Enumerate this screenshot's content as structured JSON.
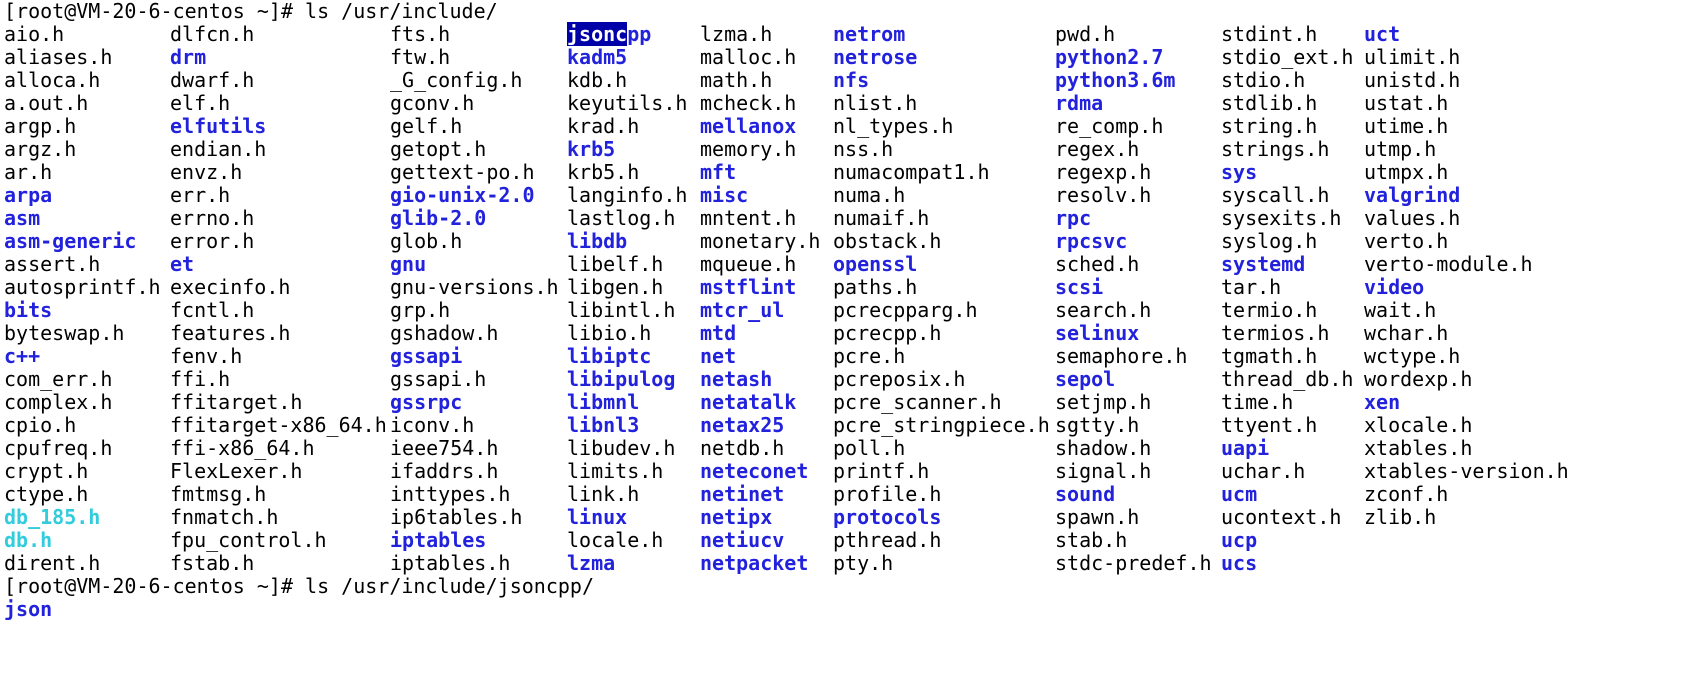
{
  "terminal": {
    "prompt1": "[root@VM-20-6-centos ~]# ls /usr/include/",
    "prompt2": "[root@VM-20-6-centos ~]# ls /usr/include/jsoncpp/",
    "second_output": [
      {
        "name": "json",
        "type": "dir"
      }
    ],
    "columns": [
      [
        {
          "name": "aio.h",
          "type": "file"
        },
        {
          "name": "aliases.h",
          "type": "file"
        },
        {
          "name": "alloca.h",
          "type": "file"
        },
        {
          "name": "a.out.h",
          "type": "file"
        },
        {
          "name": "argp.h",
          "type": "file"
        },
        {
          "name": "argz.h",
          "type": "file"
        },
        {
          "name": "ar.h",
          "type": "file"
        },
        {
          "name": "arpa",
          "type": "dir"
        },
        {
          "name": "asm",
          "type": "dir"
        },
        {
          "name": "asm-generic",
          "type": "dir"
        },
        {
          "name": "assert.h",
          "type": "file"
        },
        {
          "name": "autosprintf.h",
          "type": "file"
        },
        {
          "name": "bits",
          "type": "dir"
        },
        {
          "name": "byteswap.h",
          "type": "file"
        },
        {
          "name": "c++",
          "type": "dir"
        },
        {
          "name": "com_err.h",
          "type": "file"
        },
        {
          "name": "complex.h",
          "type": "file"
        },
        {
          "name": "cpio.h",
          "type": "file"
        },
        {
          "name": "cpufreq.h",
          "type": "file"
        },
        {
          "name": "crypt.h",
          "type": "file"
        },
        {
          "name": "ctype.h",
          "type": "file"
        },
        {
          "name": "db_185.h",
          "type": "link"
        },
        {
          "name": "db.h",
          "type": "link"
        },
        {
          "name": "dirent.h",
          "type": "file"
        }
      ],
      [
        {
          "name": "dlfcn.h",
          "type": "file"
        },
        {
          "name": "drm",
          "type": "dir"
        },
        {
          "name": "dwarf.h",
          "type": "file"
        },
        {
          "name": "elf.h",
          "type": "file"
        },
        {
          "name": "elfutils",
          "type": "dir"
        },
        {
          "name": "endian.h",
          "type": "file"
        },
        {
          "name": "envz.h",
          "type": "file"
        },
        {
          "name": "err.h",
          "type": "file"
        },
        {
          "name": "errno.h",
          "type": "file"
        },
        {
          "name": "error.h",
          "type": "file"
        },
        {
          "name": "et",
          "type": "dir"
        },
        {
          "name": "execinfo.h",
          "type": "file"
        },
        {
          "name": "fcntl.h",
          "type": "file"
        },
        {
          "name": "features.h",
          "type": "file"
        },
        {
          "name": "fenv.h",
          "type": "file"
        },
        {
          "name": "ffi.h",
          "type": "file"
        },
        {
          "name": "ffitarget.h",
          "type": "file"
        },
        {
          "name": "ffitarget-x86_64.h",
          "type": "file"
        },
        {
          "name": "ffi-x86_64.h",
          "type": "file"
        },
        {
          "name": "FlexLexer.h",
          "type": "file"
        },
        {
          "name": "fmtmsg.h",
          "type": "file"
        },
        {
          "name": "fnmatch.h",
          "type": "file"
        },
        {
          "name": "fpu_control.h",
          "type": "file"
        },
        {
          "name": "fstab.h",
          "type": "file"
        }
      ],
      [
        {
          "name": "fts.h",
          "type": "file"
        },
        {
          "name": "ftw.h",
          "type": "file"
        },
        {
          "name": "_G_config.h",
          "type": "file"
        },
        {
          "name": "gconv.h",
          "type": "file"
        },
        {
          "name": "gelf.h",
          "type": "file"
        },
        {
          "name": "getopt.h",
          "type": "file"
        },
        {
          "name": "gettext-po.h",
          "type": "file"
        },
        {
          "name": "gio-unix-2.0",
          "type": "dir"
        },
        {
          "name": "glib-2.0",
          "type": "dir"
        },
        {
          "name": "glob.h",
          "type": "file"
        },
        {
          "name": "gnu",
          "type": "dir"
        },
        {
          "name": "gnu-versions.h",
          "type": "file"
        },
        {
          "name": "grp.h",
          "type": "file"
        },
        {
          "name": "gshadow.h",
          "type": "file"
        },
        {
          "name": "gssapi",
          "type": "dir"
        },
        {
          "name": "gssapi.h",
          "type": "file"
        },
        {
          "name": "gssrpc",
          "type": "dir"
        },
        {
          "name": "iconv.h",
          "type": "file"
        },
        {
          "name": "ieee754.h",
          "type": "file"
        },
        {
          "name": "ifaddrs.h",
          "type": "file"
        },
        {
          "name": "inttypes.h",
          "type": "file"
        },
        {
          "name": "ip6tables.h",
          "type": "file"
        },
        {
          "name": "iptables",
          "type": "dir"
        },
        {
          "name": "iptables.h",
          "type": "file"
        }
      ],
      [
        {
          "name": "jsoncpp",
          "type": "dir",
          "selected_part": "jsonc",
          "rest_part": "pp"
        },
        {
          "name": "kadm5",
          "type": "dir"
        },
        {
          "name": "kdb.h",
          "type": "file"
        },
        {
          "name": "keyutils.h",
          "type": "file"
        },
        {
          "name": "krad.h",
          "type": "file"
        },
        {
          "name": "krb5",
          "type": "dir"
        },
        {
          "name": "krb5.h",
          "type": "file"
        },
        {
          "name": "langinfo.h",
          "type": "file"
        },
        {
          "name": "lastlog.h",
          "type": "file"
        },
        {
          "name": "libdb",
          "type": "dir"
        },
        {
          "name": "libelf.h",
          "type": "file"
        },
        {
          "name": "libgen.h",
          "type": "file"
        },
        {
          "name": "libintl.h",
          "type": "file"
        },
        {
          "name": "libio.h",
          "type": "file"
        },
        {
          "name": "libiptc",
          "type": "dir"
        },
        {
          "name": "libipulog",
          "type": "dir"
        },
        {
          "name": "libmnl",
          "type": "dir"
        },
        {
          "name": "libnl3",
          "type": "dir"
        },
        {
          "name": "libudev.h",
          "type": "file"
        },
        {
          "name": "limits.h",
          "type": "file"
        },
        {
          "name": "link.h",
          "type": "file"
        },
        {
          "name": "linux",
          "type": "dir"
        },
        {
          "name": "locale.h",
          "type": "file"
        },
        {
          "name": "lzma",
          "type": "dir"
        }
      ],
      [
        {
          "name": "lzma.h",
          "type": "file"
        },
        {
          "name": "malloc.h",
          "type": "file"
        },
        {
          "name": "math.h",
          "type": "file"
        },
        {
          "name": "mcheck.h",
          "type": "file"
        },
        {
          "name": "mellanox",
          "type": "dir"
        },
        {
          "name": "memory.h",
          "type": "file"
        },
        {
          "name": "mft",
          "type": "dir"
        },
        {
          "name": "misc",
          "type": "dir"
        },
        {
          "name": "mntent.h",
          "type": "file"
        },
        {
          "name": "monetary.h",
          "type": "file"
        },
        {
          "name": "mqueue.h",
          "type": "file"
        },
        {
          "name": "mstflint",
          "type": "dir"
        },
        {
          "name": "mtcr_ul",
          "type": "dir"
        },
        {
          "name": "mtd",
          "type": "dir"
        },
        {
          "name": "net",
          "type": "dir"
        },
        {
          "name": "netash",
          "type": "dir"
        },
        {
          "name": "netatalk",
          "type": "dir"
        },
        {
          "name": "netax25",
          "type": "dir"
        },
        {
          "name": "netdb.h",
          "type": "file"
        },
        {
          "name": "neteconet",
          "type": "dir"
        },
        {
          "name": "netinet",
          "type": "dir"
        },
        {
          "name": "netipx",
          "type": "dir"
        },
        {
          "name": "netiucv",
          "type": "dir"
        },
        {
          "name": "netpacket",
          "type": "dir"
        }
      ],
      [
        {
          "name": "netrom",
          "type": "dir"
        },
        {
          "name": "netrose",
          "type": "dir"
        },
        {
          "name": "nfs",
          "type": "dir"
        },
        {
          "name": "nlist.h",
          "type": "file"
        },
        {
          "name": "nl_types.h",
          "type": "file"
        },
        {
          "name": "nss.h",
          "type": "file"
        },
        {
          "name": "numacompat1.h",
          "type": "file"
        },
        {
          "name": "numa.h",
          "type": "file"
        },
        {
          "name": "numaif.h",
          "type": "file"
        },
        {
          "name": "obstack.h",
          "type": "file"
        },
        {
          "name": "openssl",
          "type": "dir"
        },
        {
          "name": "paths.h",
          "type": "file"
        },
        {
          "name": "pcrecpparg.h",
          "type": "file"
        },
        {
          "name": "pcrecpp.h",
          "type": "file"
        },
        {
          "name": "pcre.h",
          "type": "file"
        },
        {
          "name": "pcreposix.h",
          "type": "file"
        },
        {
          "name": "pcre_scanner.h",
          "type": "file"
        },
        {
          "name": "pcre_stringpiece.h",
          "type": "file"
        },
        {
          "name": "poll.h",
          "type": "file"
        },
        {
          "name": "printf.h",
          "type": "file"
        },
        {
          "name": "profile.h",
          "type": "file"
        },
        {
          "name": "protocols",
          "type": "dir"
        },
        {
          "name": "pthread.h",
          "type": "file"
        },
        {
          "name": "pty.h",
          "type": "file"
        }
      ],
      [
        {
          "name": "pwd.h",
          "type": "file"
        },
        {
          "name": "python2.7",
          "type": "dir"
        },
        {
          "name": "python3.6m",
          "type": "dir"
        },
        {
          "name": "rdma",
          "type": "dir"
        },
        {
          "name": "re_comp.h",
          "type": "file"
        },
        {
          "name": "regex.h",
          "type": "file"
        },
        {
          "name": "regexp.h",
          "type": "file"
        },
        {
          "name": "resolv.h",
          "type": "file"
        },
        {
          "name": "rpc",
          "type": "dir"
        },
        {
          "name": "rpcsvc",
          "type": "dir"
        },
        {
          "name": "sched.h",
          "type": "file"
        },
        {
          "name": "scsi",
          "type": "dir"
        },
        {
          "name": "search.h",
          "type": "file"
        },
        {
          "name": "selinux",
          "type": "dir"
        },
        {
          "name": "semaphore.h",
          "type": "file"
        },
        {
          "name": "sepol",
          "type": "dir"
        },
        {
          "name": "setjmp.h",
          "type": "file"
        },
        {
          "name": "sgtty.h",
          "type": "file"
        },
        {
          "name": "shadow.h",
          "type": "file"
        },
        {
          "name": "signal.h",
          "type": "file"
        },
        {
          "name": "sound",
          "type": "dir"
        },
        {
          "name": "spawn.h",
          "type": "file"
        },
        {
          "name": "stab.h",
          "type": "file"
        },
        {
          "name": "stdc-predef.h",
          "type": "file"
        }
      ],
      [
        {
          "name": "stdint.h",
          "type": "file"
        },
        {
          "name": "stdio_ext.h",
          "type": "file"
        },
        {
          "name": "stdio.h",
          "type": "file"
        },
        {
          "name": "stdlib.h",
          "type": "file"
        },
        {
          "name": "string.h",
          "type": "file"
        },
        {
          "name": "strings.h",
          "type": "file"
        },
        {
          "name": "sys",
          "type": "dir"
        },
        {
          "name": "syscall.h",
          "type": "file"
        },
        {
          "name": "sysexits.h",
          "type": "file"
        },
        {
          "name": "syslog.h",
          "type": "file"
        },
        {
          "name": "systemd",
          "type": "dir"
        },
        {
          "name": "tar.h",
          "type": "file"
        },
        {
          "name": "termio.h",
          "type": "file"
        },
        {
          "name": "termios.h",
          "type": "file"
        },
        {
          "name": "tgmath.h",
          "type": "file"
        },
        {
          "name": "thread_db.h",
          "type": "file"
        },
        {
          "name": "time.h",
          "type": "file"
        },
        {
          "name": "ttyent.h",
          "type": "file"
        },
        {
          "name": "uapi",
          "type": "dir"
        },
        {
          "name": "uchar.h",
          "type": "file"
        },
        {
          "name": "ucm",
          "type": "dir"
        },
        {
          "name": "ucontext.h",
          "type": "file"
        },
        {
          "name": "ucp",
          "type": "dir"
        },
        {
          "name": "ucs",
          "type": "dir"
        }
      ],
      [
        {
          "name": "uct",
          "type": "dir"
        },
        {
          "name": "ulimit.h",
          "type": "file"
        },
        {
          "name": "unistd.h",
          "type": "file"
        },
        {
          "name": "ustat.h",
          "type": "file"
        },
        {
          "name": "utime.h",
          "type": "file"
        },
        {
          "name": "utmp.h",
          "type": "file"
        },
        {
          "name": "utmpx.h",
          "type": "file"
        },
        {
          "name": "valgrind",
          "type": "dir"
        },
        {
          "name": "values.h",
          "type": "file"
        },
        {
          "name": "verto.h",
          "type": "file"
        },
        {
          "name": "verto-module.h",
          "type": "file"
        },
        {
          "name": "video",
          "type": "dir"
        },
        {
          "name": "wait.h",
          "type": "file"
        },
        {
          "name": "wchar.h",
          "type": "file"
        },
        {
          "name": "wctype.h",
          "type": "file"
        },
        {
          "name": "wordexp.h",
          "type": "file"
        },
        {
          "name": "xen",
          "type": "dir"
        },
        {
          "name": "xlocale.h",
          "type": "file"
        },
        {
          "name": "xtables.h",
          "type": "file"
        },
        {
          "name": "xtables-version.h",
          "type": "file"
        },
        {
          "name": "zconf.h",
          "type": "file"
        },
        {
          "name": "zlib.h",
          "type": "file"
        }
      ]
    ]
  },
  "colors": {
    "background": "#ffffff",
    "text": "#000000",
    "directory": "#2222dd",
    "symlink": "#33ccdd",
    "selection_bg": "#0000a8",
    "selection_fg": "#ffffff"
  }
}
